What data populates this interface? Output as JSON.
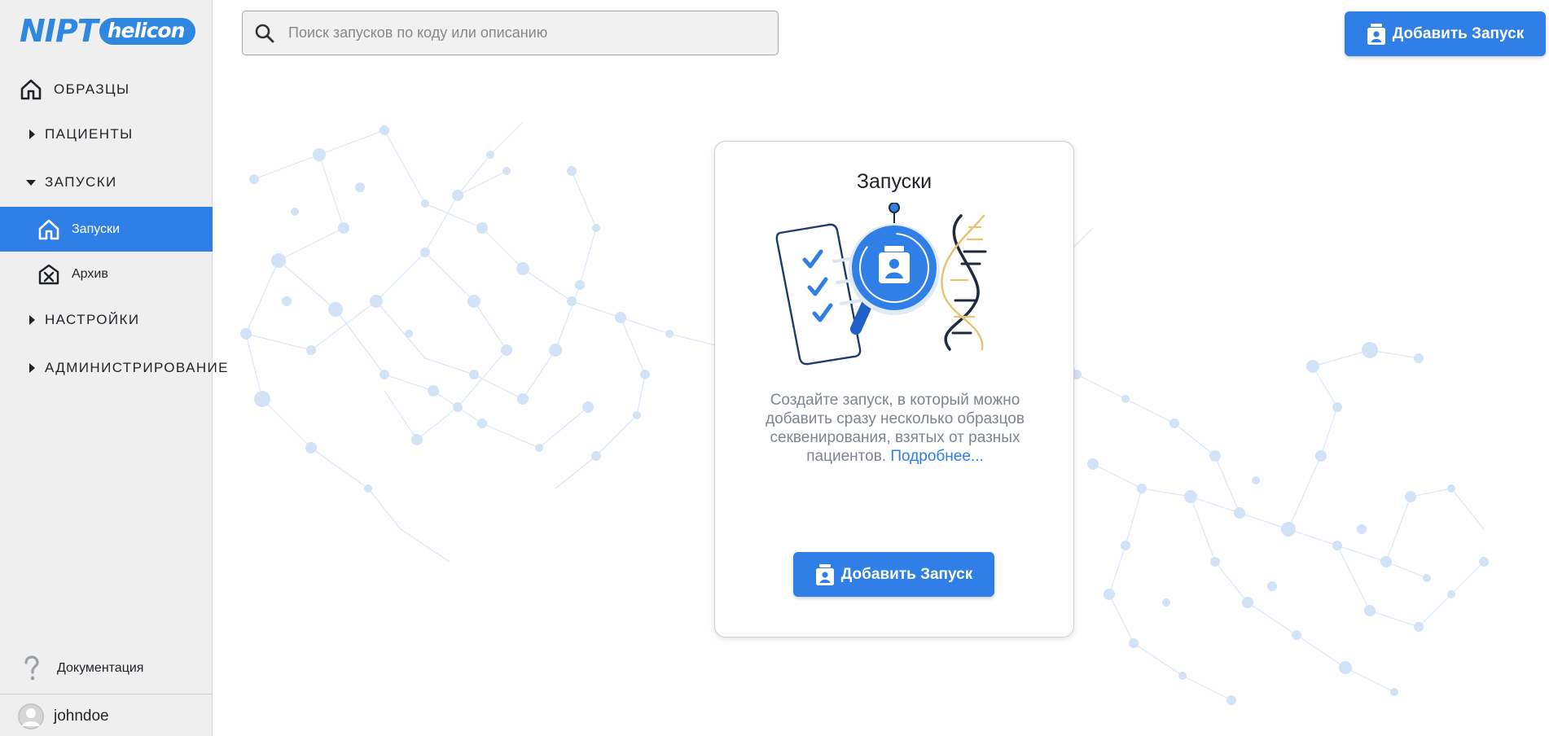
{
  "brand": {
    "name_left": "NIPT",
    "name_right": "helicon",
    "color": "#2f87e0"
  },
  "sidebar": {
    "samples": "ОБРАЗЦЫ",
    "patients": "ПАЦИЕНТЫ",
    "runs": "ЗАПУСКИ",
    "runs_sub": [
      {
        "label": "Запуски",
        "active": true
      },
      {
        "label": "Архив",
        "active": false
      }
    ],
    "settings": "НАСТРОЙКИ",
    "admin": "АДМИНИСТРИРОВАНИЕ",
    "docs": "Документация",
    "user": "johndoe"
  },
  "search": {
    "placeholder": "Поиск запусков по коду или описанию",
    "value": ""
  },
  "toolbar": {
    "add_run": "Добавить Запуск"
  },
  "empty_state": {
    "title": "Запуски",
    "description": "Создайте запуск, в который можно добавить сразу несколько образцов секвенирования, взятых от разных пациентов.",
    "more_link": "Подробнее...",
    "button": "Добавить Запуск"
  },
  "colors": {
    "accent": "#2f7fe6",
    "sidebar_bg": "#efefef",
    "network": "#c9ddf5"
  }
}
